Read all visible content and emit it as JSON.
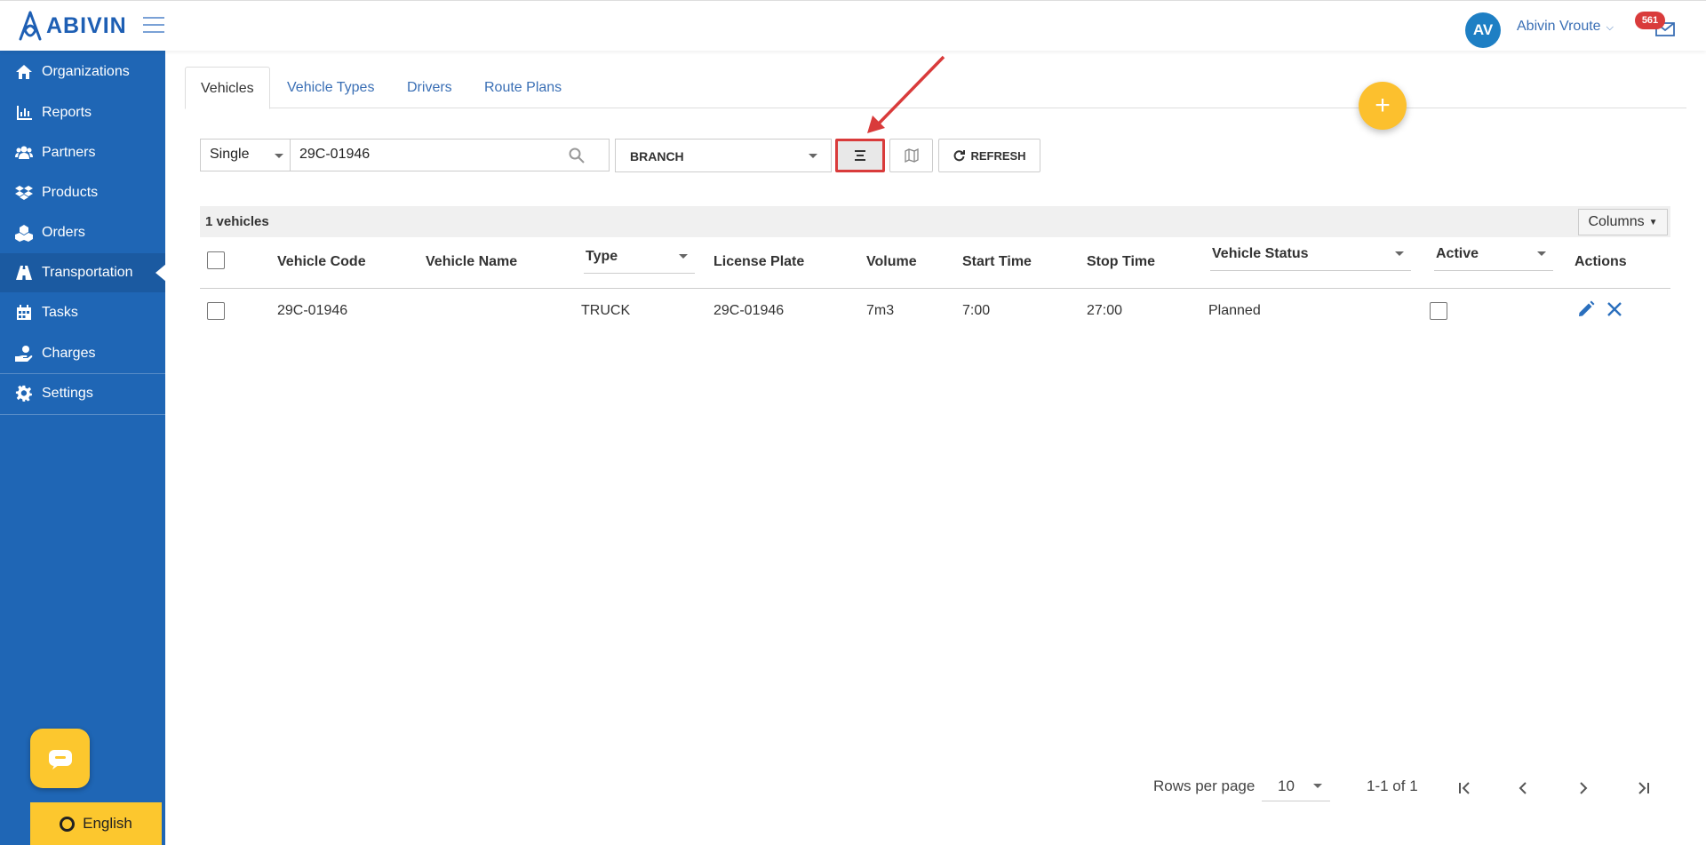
{
  "header": {
    "logo_text": "ABIVIN",
    "avatar_initials": "AV",
    "user_name": "Abivin Vroute",
    "notification_count": "561"
  },
  "sidebar": {
    "items": [
      {
        "label": "Organizations",
        "icon": "home-icon"
      },
      {
        "label": "Reports",
        "icon": "bar-chart-icon"
      },
      {
        "label": "Partners",
        "icon": "users-icon"
      },
      {
        "label": "Products",
        "icon": "dropbox-icon"
      },
      {
        "label": "Orders",
        "icon": "cubes-icon"
      },
      {
        "label": "Transportation",
        "icon": "road-icon",
        "active": true
      },
      {
        "label": "Tasks",
        "icon": "calendar-icon"
      },
      {
        "label": "Charges",
        "icon": "hand-money-icon"
      },
      {
        "label": "Settings",
        "icon": "gear-icon"
      }
    ],
    "language": "English"
  },
  "tabs": [
    "Vehicles",
    "Vehicle Types",
    "Drivers",
    "Route Plans"
  ],
  "filters": {
    "mode": "Single",
    "search_value": "29C-01946",
    "branch": "BRANCH",
    "refresh_label": "REFRESH"
  },
  "table": {
    "count_label": "1 vehicles",
    "columns_button": "Columns",
    "headers": {
      "code": "Vehicle Code",
      "name": "Vehicle Name",
      "type": "Type",
      "plate": "License Plate",
      "volume": "Volume",
      "start": "Start Time",
      "stop": "Stop Time",
      "status": "Vehicle Status",
      "active": "Active",
      "actions": "Actions"
    },
    "rows": [
      {
        "code": "29C-01946",
        "name": "",
        "type": "TRUCK",
        "plate": "29C-01946",
        "volume": "7m3",
        "start": "7:00",
        "stop": "27:00",
        "status": "Planned",
        "active": false
      }
    ]
  },
  "pagination": {
    "rows_per_page_label": "Rows per page",
    "rows_per_page": "10",
    "range": "1-1 of 1"
  },
  "colors": {
    "sidebar": "#1f66b5",
    "accent": "#fcc72e",
    "link": "#3a6fb5",
    "highlight": "#d93b3b"
  }
}
